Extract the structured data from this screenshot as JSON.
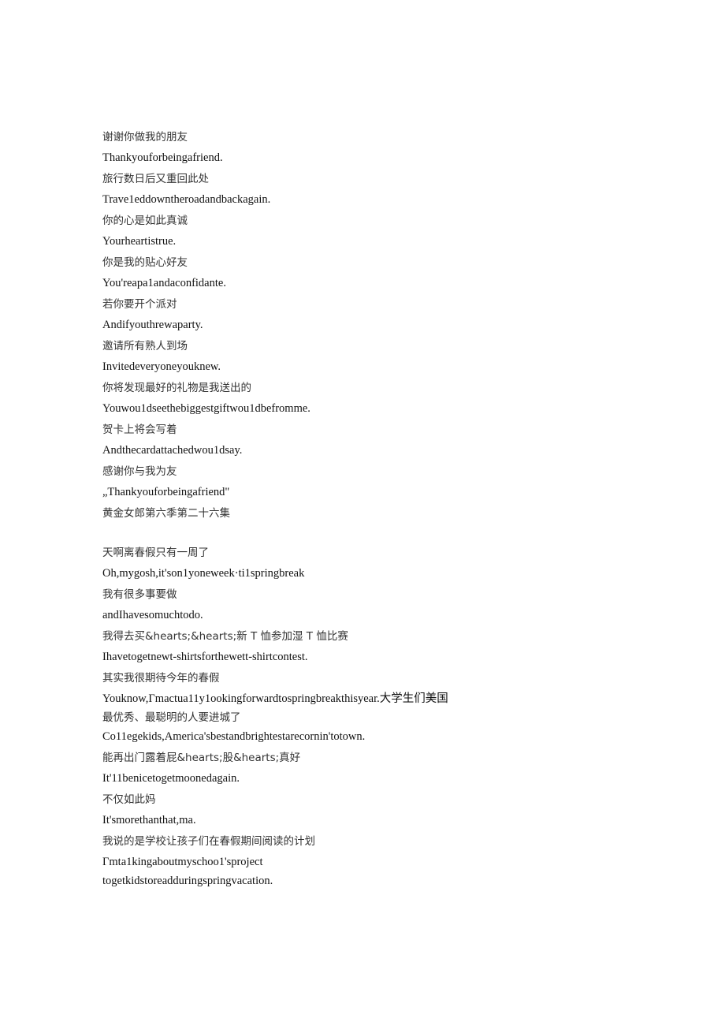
{
  "document": {
    "section1": {
      "lines": [
        {
          "lang": "zh",
          "text": "谢谢你做我的朋友"
        },
        {
          "lang": "en",
          "text": "Thankyouforbeingafriend."
        },
        {
          "lang": "zh",
          "text": "旅行数日后又重回此处"
        },
        {
          "lang": "en",
          "text": "Trave1eddowntheroadandbackagain."
        },
        {
          "lang": "zh",
          "text": "你的心是如此真诚"
        },
        {
          "lang": "en",
          "text": "Yourheartistrue."
        },
        {
          "lang": "zh",
          "text": "你是我的贴心好友"
        },
        {
          "lang": "en",
          "text": "You'reapa1andaconfidante."
        },
        {
          "lang": "zh",
          "text": "若你要开个派对"
        },
        {
          "lang": "en",
          "text": "Andifyouthrewaparty."
        },
        {
          "lang": "zh",
          "text": "邀请所有熟人到场"
        },
        {
          "lang": "en",
          "text": "Invitedeveryoneyouknew."
        },
        {
          "lang": "zh",
          "text": "你将发现最好的礼物是我送出的"
        },
        {
          "lang": "en",
          "text": "Youwou1dseethebiggestgiftwou1dbefromme."
        },
        {
          "lang": "zh",
          "text": "贺卡上将会写着"
        },
        {
          "lang": "en",
          "text": "Andthecardattachedwou1dsay."
        },
        {
          "lang": "zh",
          "text": "感谢你与我为友"
        },
        {
          "lang": "en",
          "text": "„Thankyouforbeingafriend\""
        },
        {
          "lang": "zh",
          "text": "黄金女郎第六季第二十六集"
        }
      ]
    },
    "section2": {
      "lines": [
        {
          "lang": "zh",
          "text": "天啊离春假只有一周了"
        },
        {
          "lang": "en",
          "text": "Oh,mygosh,it'son1yoneweek·ti1springbreak"
        },
        {
          "lang": "zh",
          "text": "我有很多事要做"
        },
        {
          "lang": "en",
          "text": "andIhavesomuchtodo."
        },
        {
          "lang": "zh",
          "text": "我得去买&hearts;&hearts;新 T 恤参加湿 T 恤比赛"
        },
        {
          "lang": "en",
          "text": "Ihavetogetnewt-shirtsforthewett-shirtcontest."
        },
        {
          "lang": "zh",
          "text": "其实我很期待今年的春假"
        },
        {
          "lang": "en",
          "text": "Youknow,Γmactua11y1ookingforwardtospringbreakthisyear.大学生们美国"
        },
        {
          "lang": "zh",
          "text": "最优秀、最聪明的人要进城了"
        },
        {
          "lang": "en",
          "text": "Co11egekids,America'sbestandbrightestarecornin'totown."
        },
        {
          "lang": "zh",
          "text": "能再出门露着屁&hearts;股&hearts;真好"
        },
        {
          "lang": "en",
          "text": "It'11benicetogetmoonedagain."
        },
        {
          "lang": "zh",
          "text": "不仅如此妈"
        },
        {
          "lang": "en",
          "text": "It'smorethanthat,ma."
        },
        {
          "lang": "zh",
          "text": "我说的是学校让孩子们在春假期间阅读的计划"
        },
        {
          "lang": "en",
          "text": "Γmta1kingaboutmyschoo1'sproject"
        },
        {
          "lang": "en",
          "text": "togetkidstoreadduringspringvacation."
        }
      ]
    }
  }
}
